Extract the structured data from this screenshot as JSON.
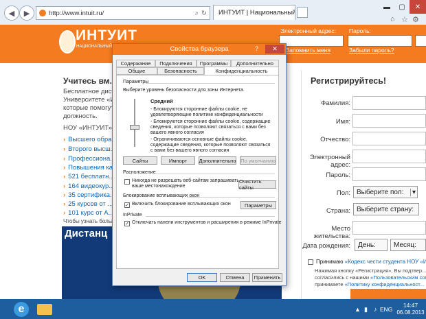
{
  "browser": {
    "url": "http://www.intuit.ru/",
    "tab_title": "ИНТУИТ | Национальный ...",
    "accent": "#f47b20"
  },
  "header": {
    "logo_text": "ИНТУИТ",
    "logo_sub": "НАЦИОНАЛЬНЫЙ ОТ...",
    "email_label": "Электронный адрес:",
    "password_label": "Пароль:",
    "remember": "Запомнить меня",
    "forgot": "Забыли пароль?"
  },
  "left": {
    "title": "Учитесь вм...",
    "para": [
      "Бесплатное диста...",
      "Университете «И...",
      "которые помогут...",
      "должность."
    ],
    "nou": "НОУ «ИНТУИТ» п...",
    "links": [
      "Высшего обра...",
      "Второго высш...",
      "Профессиона...",
      "Повышения ка...",
      "521 бесплатн...",
      "164 видеокур...",
      "35 сертифика...",
      "25 курсов от ...",
      "101 курс от А..."
    ],
    "foot": "Чтобы узнать больш...",
    "banner_text": "Дистанц"
  },
  "register": {
    "title": "Регистрируйтесь!",
    "fields": [
      "Фамилия:",
      "Имя:",
      "Отчество:",
      "Электронный адрес:",
      "Пароль:",
      "Пол:",
      "Страна:",
      "Место жительства:",
      "Дата рождения:"
    ],
    "gender_placeholder": "Выберите пол:",
    "country_placeholder": "Выберите страну:",
    "day": "День:",
    "month": "Месяц:",
    "accept_prefix": "Принимаю ",
    "accept_link": "«Кодекс чести студента НОУ «ИН...",
    "note1": "Нажимая кнопку «Регистрация», Вы подтвер...",
    "note2_prefix": "согласились с нашими ",
    "note2_link": "«Пользовательским сог...",
    "note3_prefix": "принимаете ",
    "note3_link": "«Политику конфиденциальност..."
  },
  "dialog": {
    "title": "Свойства браузера",
    "help": "?",
    "close": "✕",
    "tabs_row1": [
      "Содержание",
      "Подключения",
      "Программы",
      "Дополнительно"
    ],
    "tabs_row2": [
      "Общие",
      "Безопасность",
      "Конфиденциальность"
    ],
    "params_label": "Параметры",
    "params_desc": "Выберите уровень безопасности для зоны Интернета.",
    "level": "Средний",
    "level_desc": [
      "- Блокируются сторонние файлы cookie, не",
      "удовлетворяющие политике конфиденциальности",
      "- Блокируются сторонние файлы cookie, содержащие",
      "сведения, которые позволяют связаться с вами без",
      "вашего явного согласия",
      "- Ограничиваются основные файлы cookie,",
      "содержащие сведения, которые позволяют связаться",
      "с вами без вашего явного согласия"
    ],
    "btn_sites": "Сайты",
    "btn_import": "Импорт",
    "btn_advanced": "Дополнительно",
    "btn_default": "По умолчанию",
    "location_label": "Расположение",
    "location_cb": [
      "Никогда не разрешать веб-сайтам запрашивать",
      "ваше местонахождение"
    ],
    "btn_clear_sites": "Очистить сайты",
    "popup_label": "Блокирование всплывающих окон",
    "popup_cb": "Включить блокирование всплывающих окон",
    "btn_params": "Параметры",
    "inprivate_label": "InPrivate",
    "inprivate_cb": "Отключать панели инструментов и расширения в режиме InPrivate",
    "btn_ok": "OK",
    "btn_cancel": "Отмена",
    "btn_apply": "Применить"
  },
  "taskbar": {
    "lang": "ENG",
    "time": "14:47",
    "date": "06.08.2013"
  }
}
